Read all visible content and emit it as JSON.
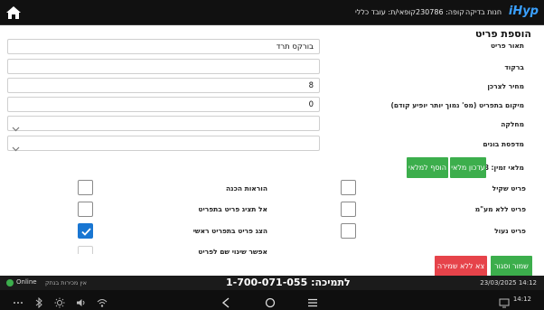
{
  "topbar": {
    "logo": "iHyp",
    "store_label": "חנות בדיקה",
    "pos_label": "קופה: 230786",
    "cashier_label": "קופאי/ת: עובד כללי"
  },
  "form": {
    "title": "הוספת פריט",
    "fields": {
      "description": {
        "label": "תאור פריט",
        "value": "בורקס תרד"
      },
      "barcode": {
        "label": "ברקוד",
        "value": ""
      },
      "price": {
        "label": "מחיר לצרכן",
        "value": "8"
      },
      "position": {
        "label": "מיקום בתפריט (מס' נמוך יותר יופיע קודם)",
        "value": "0"
      },
      "department": {
        "label": "מחלקה",
        "value": ""
      },
      "kitchen_printer": {
        "label": "מדפסת בונים",
        "value": ""
      }
    },
    "stock": {
      "label": "מלאי זמין: 8-",
      "update_button": "עדכון מלאי",
      "add_button": "הוסף למלאי"
    },
    "checkboxes": {
      "weighted": {
        "label": "פריט שקיל",
        "checked": false
      },
      "no_vat": {
        "label": "פריט ללא מע\"מ",
        "checked": false
      },
      "locked": {
        "label": "פריט נעול",
        "checked": false
      },
      "prep_instructions": {
        "label": "הוראות הכנה",
        "checked": false
      },
      "hide_in_menu": {
        "label": "אל תציג פריט בתפריט",
        "checked": false
      },
      "main_menu": {
        "label": "הצג פריט בתפריט ראשי",
        "checked": true
      },
      "allow_rename": {
        "label": "אפשר שינוי שם לפריט",
        "checked": false
      }
    },
    "actions": {
      "save_close": "שמור וסגור",
      "exit_no_save": "צא ללא שמירה"
    }
  },
  "status": {
    "online": "Online",
    "offline_sales": "אין מכירות בנתק",
    "support": "לתמיכה: 1-700-071-055",
    "datetime": "23/03/2025 14:12",
    "indicator_color": "#3cae4c"
  },
  "navbar": {
    "clock": "14:12",
    "icons": [
      "more-icon",
      "bluetooth-icon",
      "brightness-icon",
      "volume-icon",
      "wifi-icon",
      "back-icon",
      "home-circle-icon",
      "recents-icon",
      "screen-icon"
    ]
  }
}
